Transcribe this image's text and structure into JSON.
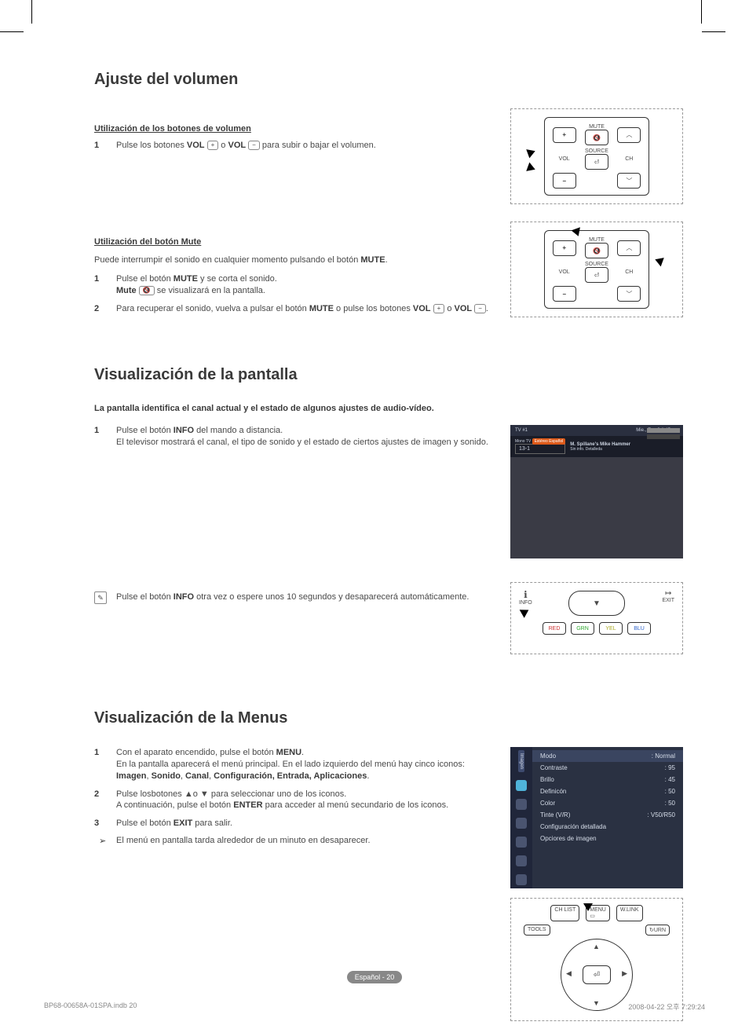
{
  "section1": {
    "title": "Ajuste del volumen",
    "sub1": "Utilización de los botones de volumen",
    "step1_pre": "Pulse los botones ",
    "step1_vol": "VOL",
    "step1_mid": " o ",
    "step1_post": " para subir o bajar el volumen.",
    "sub2": "Utilización del botón Mute",
    "intro2": "Puede interrumpir el sonido en cualquier momento pulsando el botón ",
    "intro2_b": "MUTE",
    "intro2_end": ".",
    "s1_pre": "Pulse el botón ",
    "s1_b": "MUTE",
    "s1_post": " y se corta el sonido.",
    "s1_line2_b": "Mute",
    "s1_line2_post": " se visualizará en la pantalla.",
    "s2_pre": "Para recuperar el sonido, vuelva a pulsar el botón ",
    "s2_b1": "MUTE",
    "s2_mid": " o pulse los botones ",
    "s2_b2": "VOL",
    "s2_mid2": " o ",
    "s2_b3": "VOL",
    "s2_end": "."
  },
  "remote": {
    "mute": "MUTE",
    "vol": "VOL",
    "source": "SOURCE",
    "ch": "CH"
  },
  "section2": {
    "title": "Visualización de la pantalla",
    "intro": "La pantalla identifica el canal actual y el estado de algunos ajustes de audio-vídeo.",
    "s1_pre": "Pulse el botón ",
    "s1_b": "INFO",
    "s1_post": " del mando a distancia.",
    "s1_line2": "El televisor mostrará el canal, el tipo de sonido y el estado de ciertos ajustes de imagen y sonido.",
    "note_pre": "Pulse el botón ",
    "note_b": "INFO",
    "note_post": " otra vez o espere unos 10 segundos y desaparecerá automáticamente."
  },
  "osd_info": {
    "ch_label": "TV #1",
    "time": "Mie., Ene 3 1:45 pm",
    "mono": "Mono TV",
    "stereo": "Estéreo Español",
    "prog": "M. Spillane's Mike Hammer",
    "chan": "13-1",
    "detail": "Sin info. Detalleda"
  },
  "remote_info": {
    "info": "INFO",
    "exit": "EXIT",
    "red": "RED",
    "grn": "GRN",
    "yel": "YEL",
    "blu": "BLU"
  },
  "section3": {
    "title": "Visualización de la Menus",
    "s1_pre": "Con el aparato encendido, pulse el botón ",
    "s1_b": "MENU",
    "s1_post": ".",
    "s1_line2_pre": "En la pantalla aparecerá el menú principal. En el lado izquierdo del menú hay cinco iconos: ",
    "s1_i1": "Imagen",
    "s1_c": ", ",
    "s1_i2": "Sonido",
    "s1_i3": "Canal",
    "s1_i4": "Configuración, Entrada, Aplicaciones",
    "s1_end": ".",
    "s2_pre": "Pulse losbotones ▲o ▼ para seleccionar uno de los iconos.",
    "s2_line2_pre": "A continuación, pulse el botón ",
    "s2_b": "ENTER",
    "s2_line2_post": " para acceder al menú secundario de los iconos.",
    "s3_pre": "Pulse el botón ",
    "s3_b": "EXIT",
    "s3_post": " para salir.",
    "arrow": "El menú en pantalla tarda alrededor de un minuto en desaparecer."
  },
  "menu_osd": {
    "tab": "Imagen",
    "rows": [
      {
        "l": "Modo",
        "v": ": Normal"
      },
      {
        "l": "Contraste",
        "v": ": 95"
      },
      {
        "l": "Brillo",
        "v": ": 45"
      },
      {
        "l": "Definicón",
        "v": ": 50"
      },
      {
        "l": "Color",
        "v": ": 50"
      },
      {
        "l": "Tinte (V/R)",
        "v": ": V50/R50"
      },
      {
        "l": "Configuración detallada",
        "v": ""
      },
      {
        "l": "Opciores de imagen",
        "v": ""
      }
    ]
  },
  "remote_menu": {
    "chlist": "CH LIST",
    "menu": "MENU",
    "wlink": "W.LINK",
    "tools": "TOOLS",
    "return": "URN"
  },
  "footer": {
    "center": "Español - 20",
    "left": "BP68-00658A-01SPA.indb   20",
    "right": "2008-04-22   오후 7:29:24"
  }
}
